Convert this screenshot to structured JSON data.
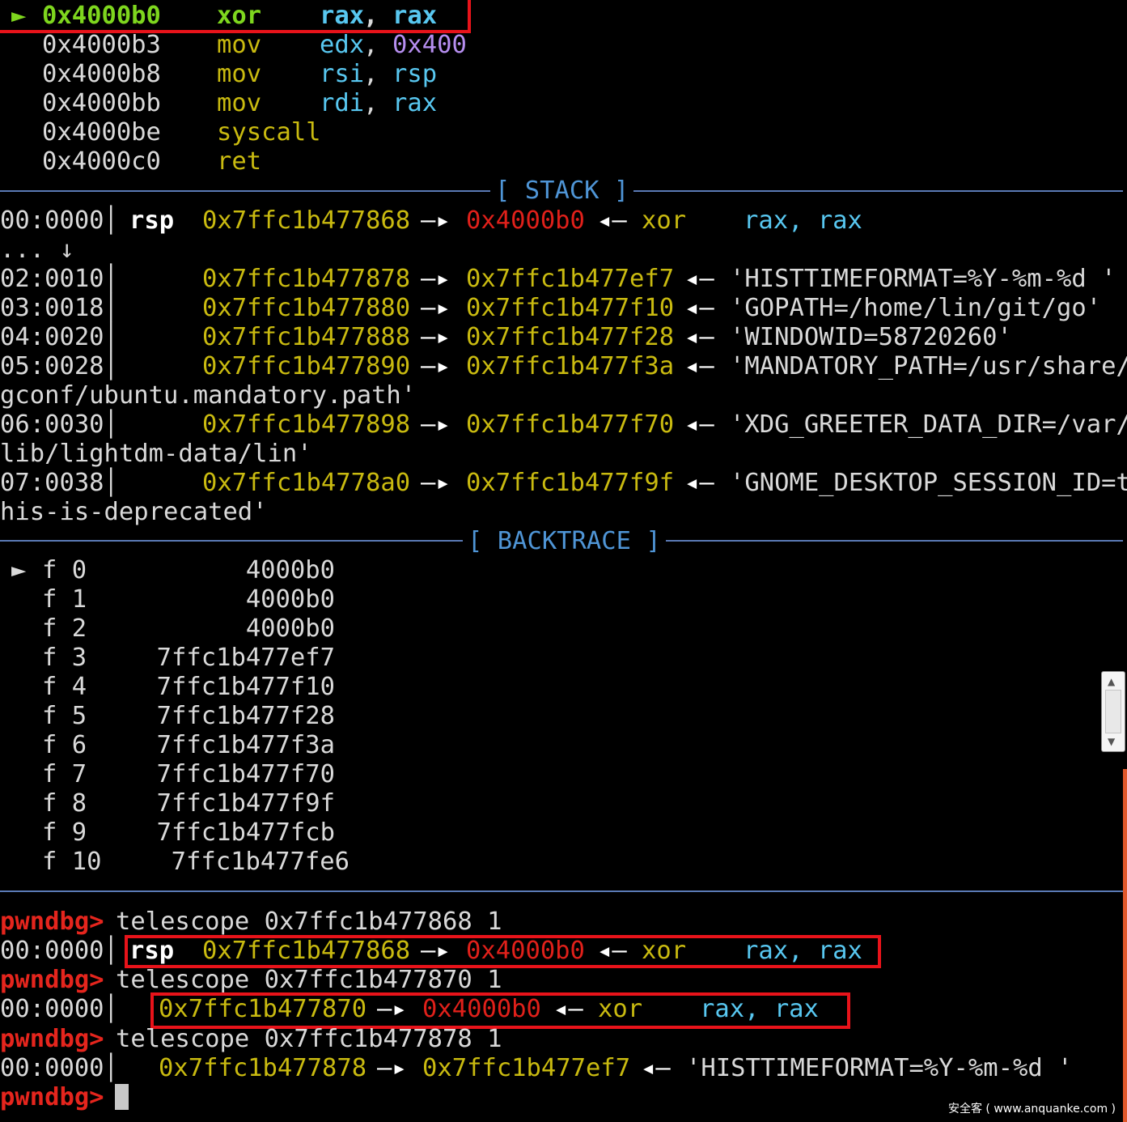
{
  "disasm": {
    "current_marker": "►",
    "lines": [
      {
        "addr": "0x4000b0",
        "mnemonic": "xor",
        "op1": "rax",
        "sep": ", ",
        "op2": "rax"
      },
      {
        "addr": "0x4000b3",
        "mnemonic": "mov",
        "op1": "edx",
        "sep": ", ",
        "op2": "0x400"
      },
      {
        "addr": "0x4000b8",
        "mnemonic": "mov",
        "op1": "rsi",
        "sep": ", ",
        "op2": "rsp"
      },
      {
        "addr": "0x4000bb",
        "mnemonic": "mov",
        "op1": "rdi",
        "sep": ", ",
        "op2": "rax"
      },
      {
        "addr": "0x4000be",
        "mnemonic": "syscall"
      },
      {
        "addr": "0x4000c0",
        "mnemonic": "ret"
      }
    ]
  },
  "stack": {
    "title": "[ STACK ]",
    "rows": [
      {
        "index": "00:0000",
        "reg": "rsp",
        "addr": "0x7ffc1b477868",
        "arrow1": "—▸",
        "target": "0x4000b0",
        "arrow2": "◂—",
        "insn": "xor",
        "operands": "rax, rax"
      },
      {
        "ellipsis": "... ↓"
      },
      {
        "index": "02:0010",
        "addr": "0x7ffc1b477878",
        "arrow1": "—▸",
        "target": "0x7ffc1b477ef7",
        "arrow2": "◂—",
        "string": "'HISTTIMEFORMAT=%Y-%m-%d '"
      },
      {
        "index": "03:0018",
        "addr": "0x7ffc1b477880",
        "arrow1": "—▸",
        "target": "0x7ffc1b477f10",
        "arrow2": "◂—",
        "string": "'GOPATH=/home/lin/git/go'"
      },
      {
        "index": "04:0020",
        "addr": "0x7ffc1b477888",
        "arrow1": "—▸",
        "target": "0x7ffc1b477f28",
        "arrow2": "◂—",
        "string": "'WINDOWID=58720260'"
      },
      {
        "index": "05:0028",
        "addr": "0x7ffc1b477890",
        "arrow1": "—▸",
        "target": "0x7ffc1b477f3a",
        "arrow2": "◂—",
        "string": "'MANDATORY_PATH=/usr/share/",
        "wrap": "gconf/ubuntu.mandatory.path'"
      },
      {
        "index": "06:0030",
        "addr": "0x7ffc1b477898",
        "arrow1": "—▸",
        "target": "0x7ffc1b477f70",
        "arrow2": "◂—",
        "string": "'XDG_GREETER_DATA_DIR=/var/",
        "wrap": "lib/lightdm-data/lin'"
      },
      {
        "index": "07:0038",
        "addr": "0x7ffc1b4778a0",
        "arrow1": "—▸",
        "target": "0x7ffc1b477f9f",
        "arrow2": "◂—",
        "string": "'GNOME_DESKTOP_SESSION_ID=t",
        "wrap": "his-is-deprecated'"
      }
    ]
  },
  "backtrace": {
    "title": "[ BACKTRACE ]",
    "marker": "►",
    "frames": [
      {
        "frame": "f 0",
        "addr": "4000b0"
      },
      {
        "frame": "f 1",
        "addr": "4000b0"
      },
      {
        "frame": "f 2",
        "addr": "4000b0"
      },
      {
        "frame": "f 3",
        "addr": "7ffc1b477ef7"
      },
      {
        "frame": "f 4",
        "addr": "7ffc1b477f10"
      },
      {
        "frame": "f 5",
        "addr": "7ffc1b477f28"
      },
      {
        "frame": "f 6",
        "addr": "7ffc1b477f3a"
      },
      {
        "frame": "f 7",
        "addr": "7ffc1b477f70"
      },
      {
        "frame": "f 8",
        "addr": "7ffc1b477f9f"
      },
      {
        "frame": "f 9",
        "addr": "7ffc1b477fcb"
      },
      {
        "frame": "f 10",
        "addr": "7ffc1b477fe6"
      }
    ]
  },
  "console": {
    "prompt": "pwndbg>",
    "commands": [
      {
        "cmd": "telescope 0x7ffc1b477868 1",
        "result": {
          "index": "00:0000",
          "reg": "rsp",
          "addr": "0x7ffc1b477868",
          "arrow1": "—▸",
          "target": "0x4000b0",
          "arrow2": "◂—",
          "insn": "xor",
          "operands": "rax, rax"
        }
      },
      {
        "cmd": "telescope 0x7ffc1b477870 1",
        "result": {
          "index": "00:0000",
          "addr": "0x7ffc1b477870",
          "arrow1": "—▸",
          "target": "0x4000b0",
          "arrow2": "◂—",
          "insn": "xor",
          "operands": "rax, rax"
        }
      },
      {
        "cmd": "telescope 0x7ffc1b477878 1",
        "result": {
          "index": "00:0000",
          "addr": "0x7ffc1b477878",
          "arrow1": "—▸",
          "target": "0x7ffc1b477ef7",
          "arrow2": "◂—",
          "string": "'HISTTIMEFORMAT=%Y-%m-%d '"
        }
      }
    ]
  },
  "watermark": "安全客 ( www.anquanke.com )",
  "colors": {
    "highlight_box": "#e8131a",
    "prompt": "#e5251d",
    "address": "#c9ba10",
    "code_pointer": "#e0201a",
    "register": "#58c7f0",
    "mnemonic": "#c9ba10",
    "current": "#7ed61e",
    "immediate": "#b68ef0",
    "section_title": "#4f95d6"
  }
}
